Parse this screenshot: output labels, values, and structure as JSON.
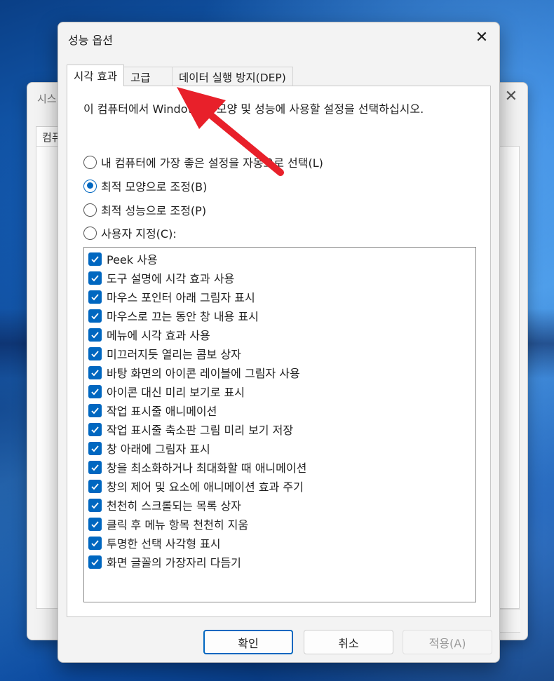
{
  "background_dialog": {
    "title": "시스",
    "tab": "컴퓨"
  },
  "dialog": {
    "title": "성능 옵션",
    "close_glyph": "✕",
    "tabs": [
      {
        "label": "시각 효과",
        "active": true
      },
      {
        "label": "고급",
        "active": false
      },
      {
        "label": "데이터 실행 방지(DEP)",
        "active": false
      }
    ],
    "description": "이 컴퓨터에서 Windows의 모양 및 성능에 사용할 설정을 선택하십시오.",
    "radios": [
      {
        "label": "내 컴퓨터에 가장 좋은 설정을 자동으로 선택(L)",
        "checked": false
      },
      {
        "label": "최적 모양으로 조정(B)",
        "checked": true
      },
      {
        "label": "최적 성능으로 조정(P)",
        "checked": false
      },
      {
        "label": "사용자 지정(C):",
        "checked": false
      }
    ],
    "options": [
      "Peek 사용",
      "도구 설명에 시각 효과 사용",
      "마우스 포인터 아래 그림자 표시",
      "마우스로 끄는 동안 창 내용 표시",
      "메뉴에 시각 효과 사용",
      "미끄러지듯 열리는 콤보 상자",
      "바탕 화면의 아이콘 레이블에 그림자 사용",
      "아이콘 대신 미리 보기로 표시",
      "작업 표시줄 애니메이션",
      "작업 표시줄 축소판 그림 미리 보기 저장",
      "창 아래에 그림자 표시",
      "창을 최소화하거나 최대화할 때 애니메이션",
      "창의 제어 및 요소에 애니메이션 효과 주기",
      "천천히 스크롤되는 목록 상자",
      "클릭 후 메뉴 항목 천천히 지움",
      "투명한 선택 사각형 표시",
      "화면 글꼴의 가장자리 다듬기"
    ],
    "buttons": {
      "ok": "확인",
      "cancel": "취소",
      "apply": "적용(A)"
    }
  },
  "colors": {
    "accent": "#0067c0",
    "annotation_arrow": "#e8202a"
  }
}
